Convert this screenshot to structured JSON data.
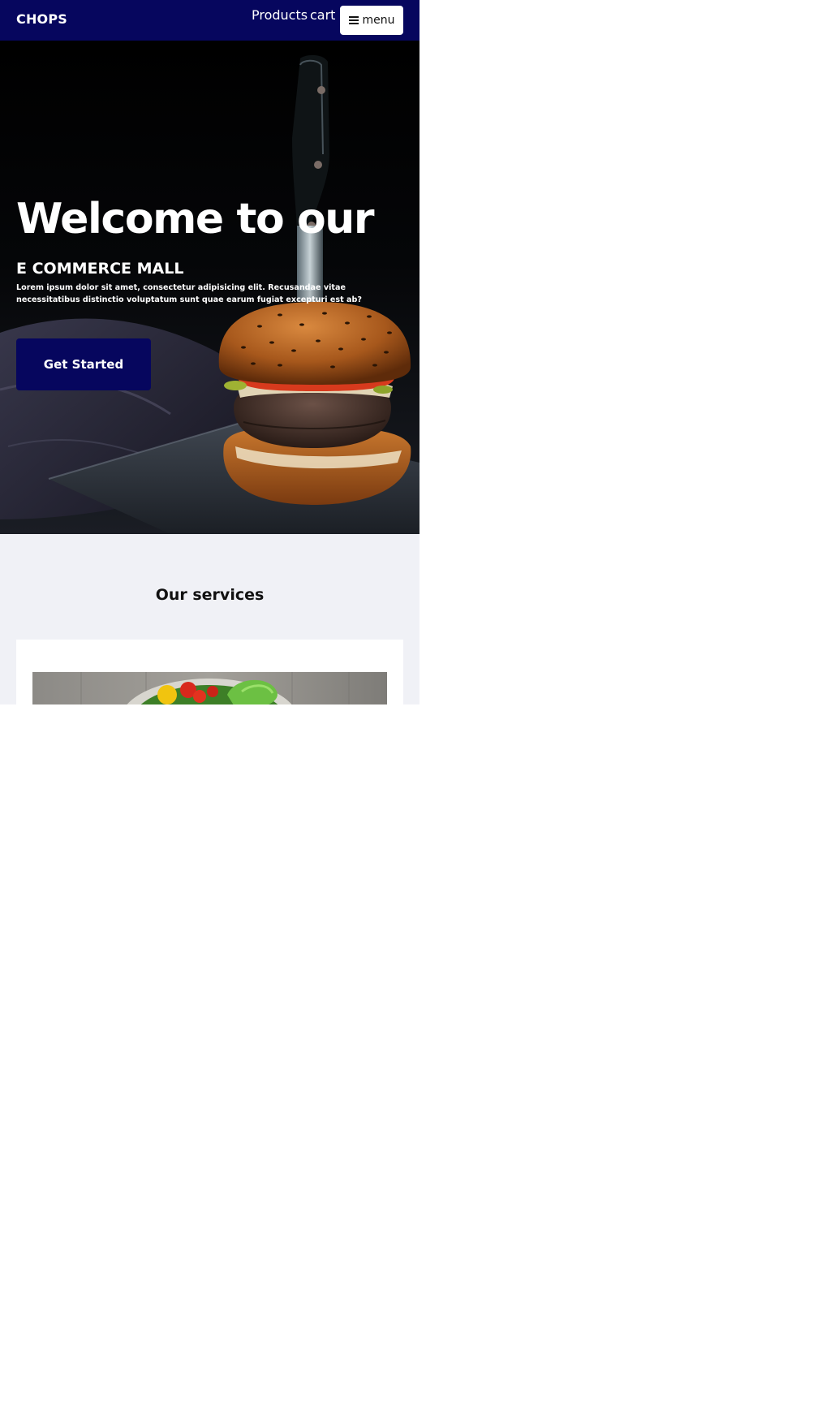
{
  "navbar": {
    "brand": "CHOPS",
    "links": [
      "Products",
      "cart"
    ],
    "menu_label": "menu",
    "background": "#06065e"
  },
  "hero": {
    "title": "Welcome to our",
    "subtitle": "E COMMERCE MALL",
    "text": "Lorem ipsum dolor sit amet, consectetur adipisicing elit. Recusandae vitae necessitatibus distinctio voluptatum sunt quae earum fugiat excepturi est ab?",
    "cta_label": "Get Started"
  },
  "services": {
    "title": "Our services"
  },
  "icons": {
    "menu": "hamburger-icon"
  },
  "colors": {
    "accent": "#06065e",
    "section_background": "#f0f1f6"
  }
}
